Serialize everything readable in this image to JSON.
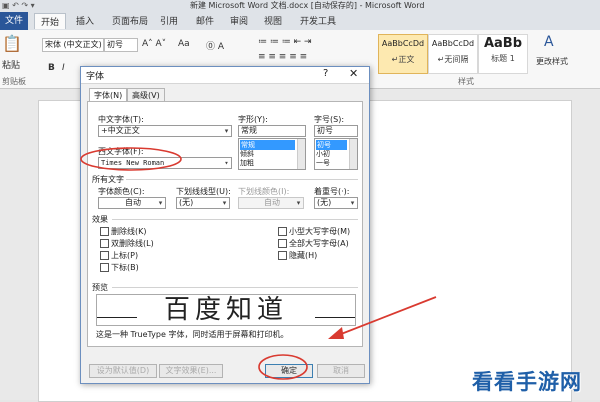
{
  "window": {
    "title": "新建 Microsoft Word 文档.docx [自动保存的] - Microsoft Word"
  },
  "ribbon_tabs": [
    "文件",
    "开始",
    "插入",
    "页面布局",
    "引用",
    "邮件",
    "审阅",
    "视图",
    "开发工具"
  ],
  "ribbon": {
    "paste_label": "粘贴",
    "clipboard_label": "剪贴板",
    "font_name": "宋体 (中文正文)",
    "font_size": "初号",
    "bold": "B",
    "italic": "I",
    "underline": "U",
    "paragraph_label": "段落",
    "styles_label": "样式",
    "change_styles_label": "更改样式",
    "styles": [
      {
        "sample": "AaBbCcDd",
        "name": "↵正文"
      },
      {
        "sample": "AaBbCcDd",
        "name": "↵无间隔"
      },
      {
        "sample": "AaBb",
        "name": "标题 1"
      }
    ]
  },
  "dialog": {
    "title": "字体",
    "help_icon": "?",
    "close_icon": "✕",
    "tabs": [
      "字体(N)",
      "高级(V)"
    ],
    "cn_font_label": "中文字体(T):",
    "cn_font_value": "+中文正文",
    "style_label": "字形(Y):",
    "style_value": "常规",
    "style_options": [
      "常规",
      "倾斜",
      "加粗"
    ],
    "size_label": "字号(S):",
    "size_value": "初号",
    "size_options": [
      "初号",
      "小初",
      "一号"
    ],
    "west_font_label": "西文字体(F):",
    "west_font_value": "Times New Roman",
    "all_text_label": "所有文字",
    "font_color_label": "字体颜色(C):",
    "font_color_value": "自动",
    "underline_type_label": "下划线线型(U):",
    "underline_type_value": "(无)",
    "underline_color_label": "下划线颜色(I):",
    "underline_color_value": "自动",
    "emphasis_label": "着重号(·):",
    "emphasis_value": "(无)",
    "effects_label": "效果",
    "effects_left": [
      "删除线(K)",
      "双删除线(L)",
      "上标(P)",
      "下标(B)"
    ],
    "effects_right": [
      "小型大写字母(M)",
      "全部大写字母(A)",
      "隐藏(H)"
    ],
    "preview_label": "预览",
    "preview_text": "百度知道",
    "truetype_note": "这是一种 TrueType 字体，同时适用于屏幕和打印机。",
    "set_default": "设为默认值(D)",
    "text_effects": "文字效果(E)...",
    "ok": "确定",
    "cancel": "取消"
  },
  "watermark": "看看手游网",
  "colors": {
    "annotation": "#d93a30",
    "file_tab": "#2a5699",
    "selection": "#3399ff",
    "watermark": "#1f5fa8"
  }
}
